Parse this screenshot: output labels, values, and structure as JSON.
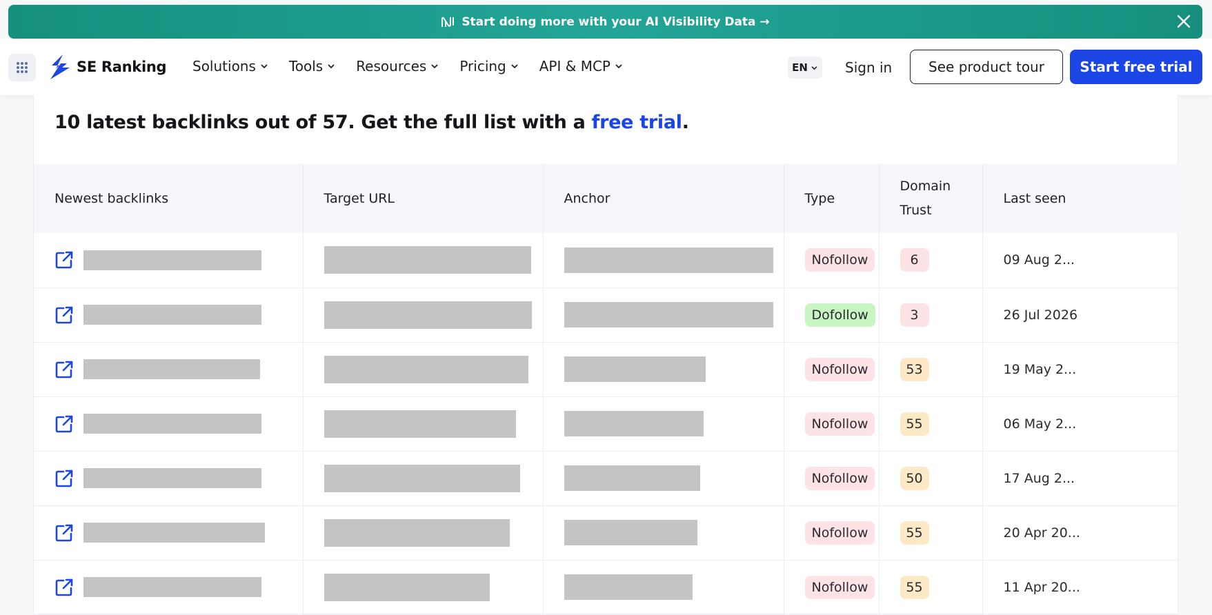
{
  "banner": {
    "text": "Start doing more with your AI Visibility Data →"
  },
  "nav": {
    "logo": "SE Ranking",
    "menu": [
      "Solutions",
      "Tools",
      "Resources",
      "Pricing",
      "API & MCP"
    ],
    "lang": "EN",
    "signin": "Sign in",
    "tour": "See product tour",
    "trial": "Start free trial"
  },
  "heading": {
    "prefix": "10 latest backlinks out of 57. Get the full list with a ",
    "link": "free trial",
    "suffix": "."
  },
  "table": {
    "columns": [
      "Newest backlinks",
      "Target URL",
      "Anchor",
      "Type",
      "Domain Trust",
      "Last seen"
    ],
    "rows": [
      {
        "type": "Nofollow",
        "dt": "6",
        "last_seen": "09 Aug 2..."
      },
      {
        "type": "Dofollow",
        "dt": "3",
        "last_seen": "26 Jul 2026"
      },
      {
        "type": "Nofollow",
        "dt": "53",
        "last_seen": "19 May 2..."
      },
      {
        "type": "Nofollow",
        "dt": "55",
        "last_seen": "06 May 2..."
      },
      {
        "type": "Nofollow",
        "dt": "50",
        "last_seen": "17 Aug 2..."
      },
      {
        "type": "Nofollow",
        "dt": "55",
        "last_seen": "20 Apr 20..."
      },
      {
        "type": "Nofollow",
        "dt": "55",
        "last_seen": "11 Apr 20..."
      }
    ]
  },
  "colors": {
    "accent": "#1c45e6",
    "banner": "#1a9a89",
    "nofollow": "#fde3e6",
    "dofollow": "#c7f6c2",
    "dt_mid": "#fde9c6"
  }
}
